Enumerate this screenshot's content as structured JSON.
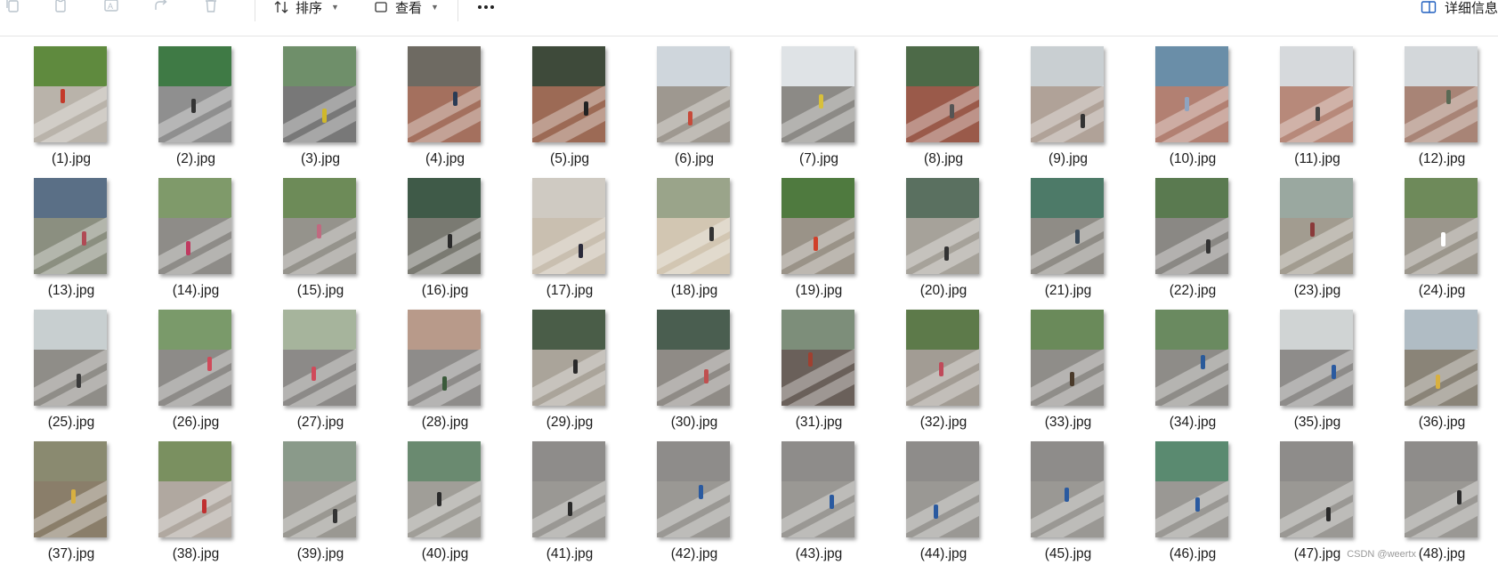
{
  "toolbar": {
    "copy_icon": "copy-icon",
    "paste_icon": "paste-icon",
    "rename_icon": "rename-icon",
    "share_icon": "share-icon",
    "delete_icon": "delete-icon",
    "sort_label": "排序",
    "view_label": "查看",
    "details_label": "详细信息"
  },
  "files": [
    {
      "name": "(1).jpg",
      "sky": "#5f8a3e",
      "ground": "#b9b3aa",
      "fig": "#c43a2a"
    },
    {
      "name": "(2).jpg",
      "sky": "#3f7a45",
      "ground": "#8f8f8f",
      "fig": "#333333"
    },
    {
      "name": "(3).jpg",
      "sky": "#6f8f6a",
      "ground": "#787878",
      "fig": "#d0b82a"
    },
    {
      "name": "(4).jpg",
      "sky": "#6e6a62",
      "ground": "#a4705e",
      "fig": "#2a3b55"
    },
    {
      "name": "(5).jpg",
      "sky": "#3e4a3a",
      "ground": "#9c6a55",
      "fig": "#222222"
    },
    {
      "name": "(6).jpg",
      "sky": "#cfd6dc",
      "ground": "#9e9890",
      "fig": "#c74a3a"
    },
    {
      "name": "(7).jpg",
      "sky": "#dfe3e6",
      "ground": "#8c8a86",
      "fig": "#d8c03a"
    },
    {
      "name": "(8).jpg",
      "sky": "#4d6a48",
      "ground": "#9a5a4a",
      "fig": "#555555"
    },
    {
      "name": "(9).jpg",
      "sky": "#c9cfd2",
      "ground": "#b0a298",
      "fig": "#333333"
    },
    {
      "name": "(10).jpg",
      "sky": "#6a8ea8",
      "ground": "#b28072",
      "fig": "#8fa4c0"
    },
    {
      "name": "(11).jpg",
      "sky": "#d6d9dc",
      "ground": "#b7897a",
      "fig": "#444444"
    },
    {
      "name": "(12).jpg",
      "sky": "#d3d7da",
      "ground": "#a88476",
      "fig": "#5a6a55"
    },
    {
      "name": "(13).jpg",
      "sky": "#5a6f86",
      "ground": "#8b8f80",
      "fig": "#b04a55"
    },
    {
      "name": "(14).jpg",
      "sky": "#7f9a6a",
      "ground": "#8e8c88",
      "fig": "#c03a60"
    },
    {
      "name": "(15).jpg",
      "sky": "#6d8b58",
      "ground": "#95938c",
      "fig": "#c06a80"
    },
    {
      "name": "(16).jpg",
      "sky": "#3f5a48",
      "ground": "#7a7a72",
      "fig": "#2a2a2a"
    },
    {
      "name": "(17).jpg",
      "sky": "#cfcac2",
      "ground": "#c9bfb0",
      "fig": "#2a2a3a"
    },
    {
      "name": "(18).jpg",
      "sky": "#9aa48a",
      "ground": "#d2c6b2",
      "fig": "#333333"
    },
    {
      "name": "(19).jpg",
      "sky": "#4f7a3f",
      "ground": "#9a9388",
      "fig": "#d0402a"
    },
    {
      "name": "(20).jpg",
      "sky": "#5a7060",
      "ground": "#a6a29a",
      "fig": "#333333"
    },
    {
      "name": "(21).jpg",
      "sky": "#4d7a68",
      "ground": "#8f8c86",
      "fig": "#3a4a5a"
    },
    {
      "name": "(22).jpg",
      "sky": "#5a7a50",
      "ground": "#8a8884",
      "fig": "#333333"
    },
    {
      "name": "(23).jpg",
      "sky": "#9aa8a0",
      "ground": "#a29c90",
      "fig": "#8a3a3a"
    },
    {
      "name": "(24).jpg",
      "sky": "#6e8a5a",
      "ground": "#9b968c",
      "fig": "#ffffff"
    },
    {
      "name": "(25).jpg",
      "sky": "#c8cfd0",
      "ground": "#8f8d88",
      "fig": "#3a3a3a"
    },
    {
      "name": "(26).jpg",
      "sky": "#7a9a6a",
      "ground": "#8d8b88",
      "fig": "#d04a5a"
    },
    {
      "name": "(27).jpg",
      "sky": "#a6b49c",
      "ground": "#8c8a88",
      "fig": "#d04a5a"
    },
    {
      "name": "(28).jpg",
      "sky": "#b89a8a",
      "ground": "#8e8c8a",
      "fig": "#3a5a3a"
    },
    {
      "name": "(29).jpg",
      "sky": "#4a5d48",
      "ground": "#aaa49a",
      "fig": "#2a2a2a"
    },
    {
      "name": "(30).jpg",
      "sky": "#4a5e50",
      "ground": "#8f8b86",
      "fig": "#c05050"
    },
    {
      "name": "(31).jpg",
      "sky": "#7d8e7a",
      "ground": "#6a605a",
      "fig": "#a04030"
    },
    {
      "name": "(32).jpg",
      "sky": "#5d7a4a",
      "ground": "#a29c94",
      "fig": "#c04a5a"
    },
    {
      "name": "(33).jpg",
      "sky": "#6a8a5a",
      "ground": "#8f8d89",
      "fig": "#4a3a2a"
    },
    {
      "name": "(34).jpg",
      "sky": "#6a8a60",
      "ground": "#8e8c88",
      "fig": "#2a5a9a"
    },
    {
      "name": "(35).jpg",
      "sky": "#d0d4d4",
      "ground": "#8e8c8a",
      "fig": "#2a5aa0"
    },
    {
      "name": "(36).jpg",
      "sky": "#b0bcc4",
      "ground": "#8a8478",
      "fig": "#d8b040"
    },
    {
      "name": "(37).jpg",
      "sky": "#8a8a70",
      "ground": "#8a7e6a",
      "fig": "#d8b040"
    },
    {
      "name": "(38).jpg",
      "sky": "#7a9060",
      "ground": "#b0a8a0",
      "fig": "#c03030"
    },
    {
      "name": "(39).jpg",
      "sky": "#8a9a8a",
      "ground": "#9a9892",
      "fig": "#333333"
    },
    {
      "name": "(40).jpg",
      "sky": "#6a8a70",
      "ground": "#a09e98",
      "fig": "#2a2a2a"
    },
    {
      "name": "(41).jpg",
      "sky": "#8e8c8a",
      "ground": "#9a9894",
      "fig": "#2a2a2a"
    },
    {
      "name": "(42).jpg",
      "sky": "#8e8c8a",
      "ground": "#9a9894",
      "fig": "#2a5aa0"
    },
    {
      "name": "(43).jpg",
      "sky": "#8e8c8a",
      "ground": "#9a9894",
      "fig": "#2a5aa0"
    },
    {
      "name": "(44).jpg",
      "sky": "#8e8c8a",
      "ground": "#9a9894",
      "fig": "#2a5aa0"
    },
    {
      "name": "(45).jpg",
      "sky": "#8e8c8a",
      "ground": "#9a9894",
      "fig": "#2a5aa0"
    },
    {
      "name": "(46).jpg",
      "sky": "#5a8a70",
      "ground": "#9a9894",
      "fig": "#2a5aa0"
    },
    {
      "name": "(47).jpg",
      "sky": "#8e8c8a",
      "ground": "#9a9894",
      "fig": "#2a2a2a"
    },
    {
      "name": "(48).jpg",
      "sky": "#8e8c8a",
      "ground": "#9a9894",
      "fig": "#2a2a2a"
    }
  ],
  "watermark": "CSDN @weertx"
}
